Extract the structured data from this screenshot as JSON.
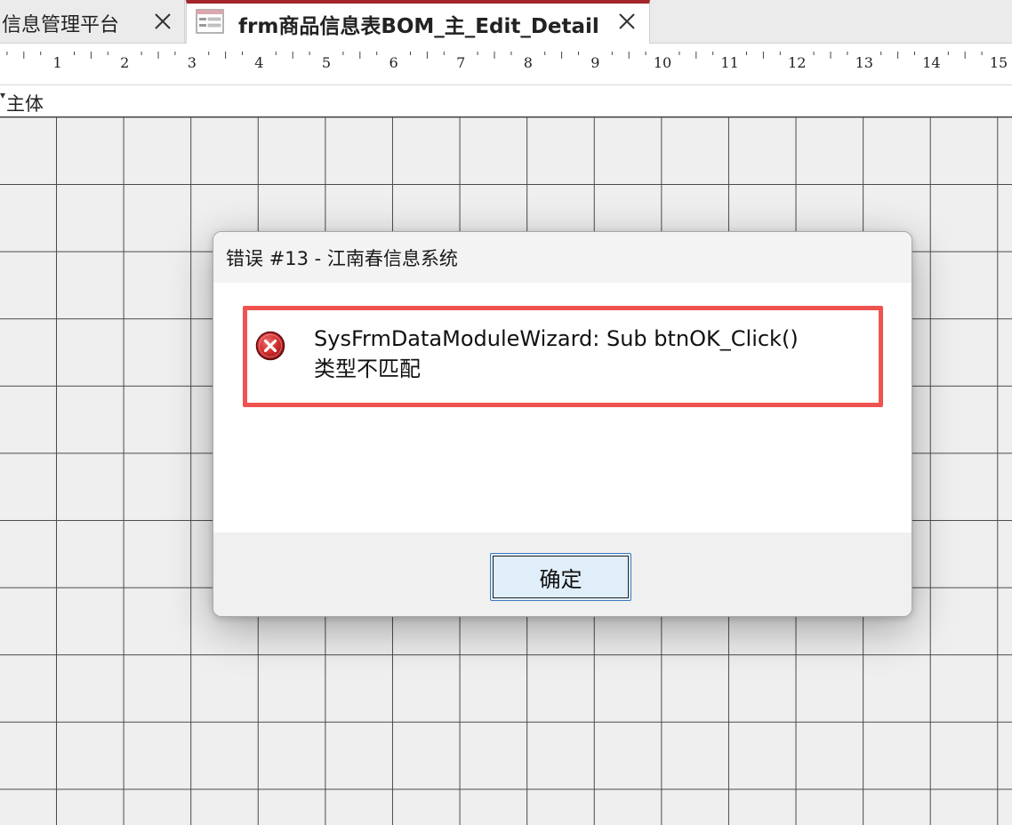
{
  "tabs": [
    {
      "label": "信息管理平台",
      "active": false
    },
    {
      "label": "frm商品信息表BOM_主_Edit_Detail",
      "active": true
    }
  ],
  "ruler": {
    "numbers": [
      "1",
      "2",
      "3",
      "4",
      "5",
      "6",
      "7",
      "8",
      "9",
      "10",
      "11",
      "12",
      "13",
      "14",
      "15"
    ]
  },
  "section": {
    "label": "主体"
  },
  "dialog": {
    "title": "错误 #13 - 江南春信息系统",
    "message_line1": "SysFrmDataModuleWizard: Sub btnOK_Click()",
    "message_line2": "类型不匹配",
    "ok_label": "确定",
    "icon": "error-icon"
  },
  "colors": {
    "active_tab_accent": "#a4262c",
    "highlight_border": "#ef5350",
    "button_bg": "#e0eef9",
    "button_border": "#3b79c0"
  }
}
